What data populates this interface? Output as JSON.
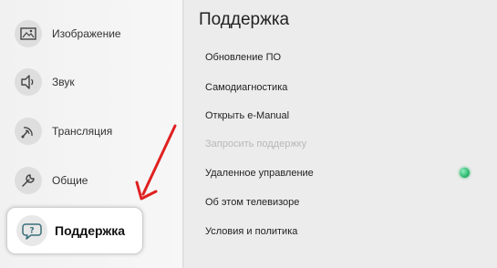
{
  "sidebar": {
    "items": [
      {
        "label": "Изображение",
        "icon": "picture-icon"
      },
      {
        "label": "Звук",
        "icon": "speaker-icon"
      },
      {
        "label": "Трансляция",
        "icon": "broadcast-icon"
      },
      {
        "label": "Общие",
        "icon": "wrench-icon"
      },
      {
        "label": "Поддержка",
        "icon": "support-chat-icon",
        "selected": true
      }
    ]
  },
  "main": {
    "title": "Поддержка",
    "items": [
      {
        "label": "Обновление ПО",
        "enabled": true
      },
      {
        "label": "Самодиагностика",
        "enabled": true
      },
      {
        "label": "Открыть e-Manual",
        "enabled": true
      },
      {
        "label": "Запросить поддержку",
        "enabled": false
      },
      {
        "label": "Удаленное управление",
        "enabled": true,
        "toggle": "on"
      },
      {
        "label": "Об этом телевизоре",
        "enabled": true
      },
      {
        "label": "Условия и политика",
        "enabled": true
      }
    ]
  },
  "colors": {
    "annotation_arrow": "#e02020",
    "status_on": "#2fb86f"
  }
}
